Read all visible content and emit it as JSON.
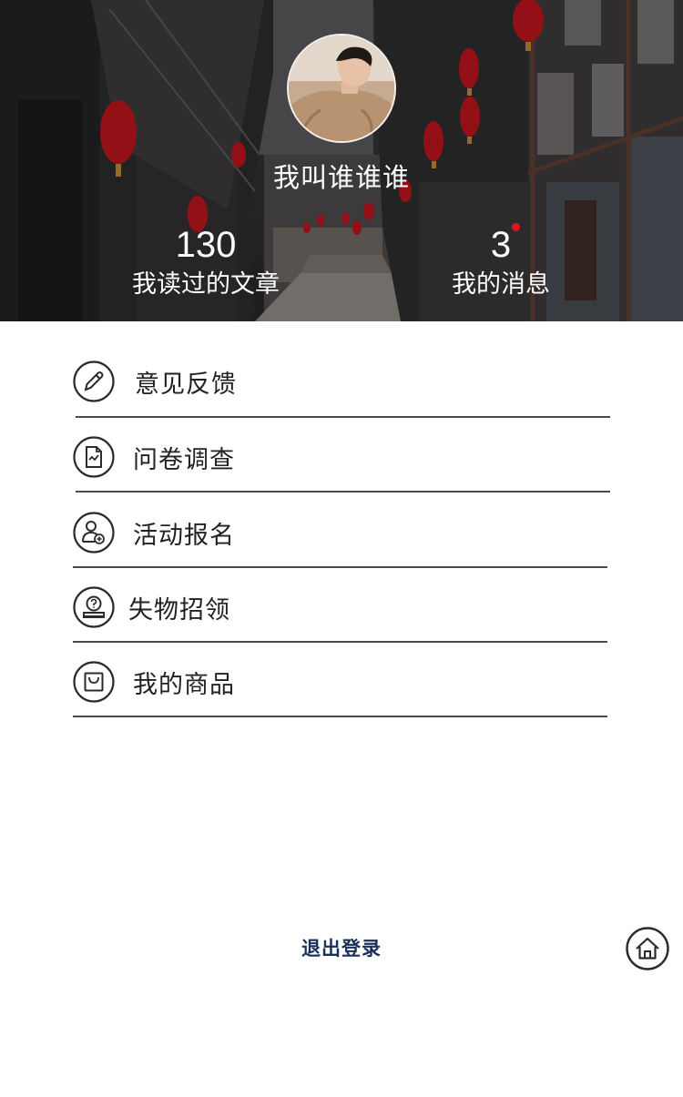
{
  "profile": {
    "username": "我叫谁谁谁",
    "avatar_icon": "user-avatar-photo"
  },
  "stats": {
    "read": {
      "value": "130",
      "label": "我读过的文章"
    },
    "messages": {
      "value": "3",
      "label": "我的消息",
      "has_unread_dot": true
    }
  },
  "menu": {
    "items": [
      {
        "label": "意见反馈",
        "icon": "pencil-icon"
      },
      {
        "label": "问卷调查",
        "icon": "survey-doc-icon"
      },
      {
        "label": "活动报名",
        "icon": "user-add-icon"
      },
      {
        "label": "失物招领",
        "icon": "lost-found-icon"
      },
      {
        "label": "我的商品",
        "icon": "shopping-bag-icon"
      }
    ]
  },
  "footer": {
    "logout_label": "退出登录",
    "home_icon": "home-icon"
  },
  "colors": {
    "logout_text": "#1a2f5a",
    "badge_dot": "#e0141e",
    "divider": "#4a4a4a",
    "lantern_red": "#b3141c"
  }
}
